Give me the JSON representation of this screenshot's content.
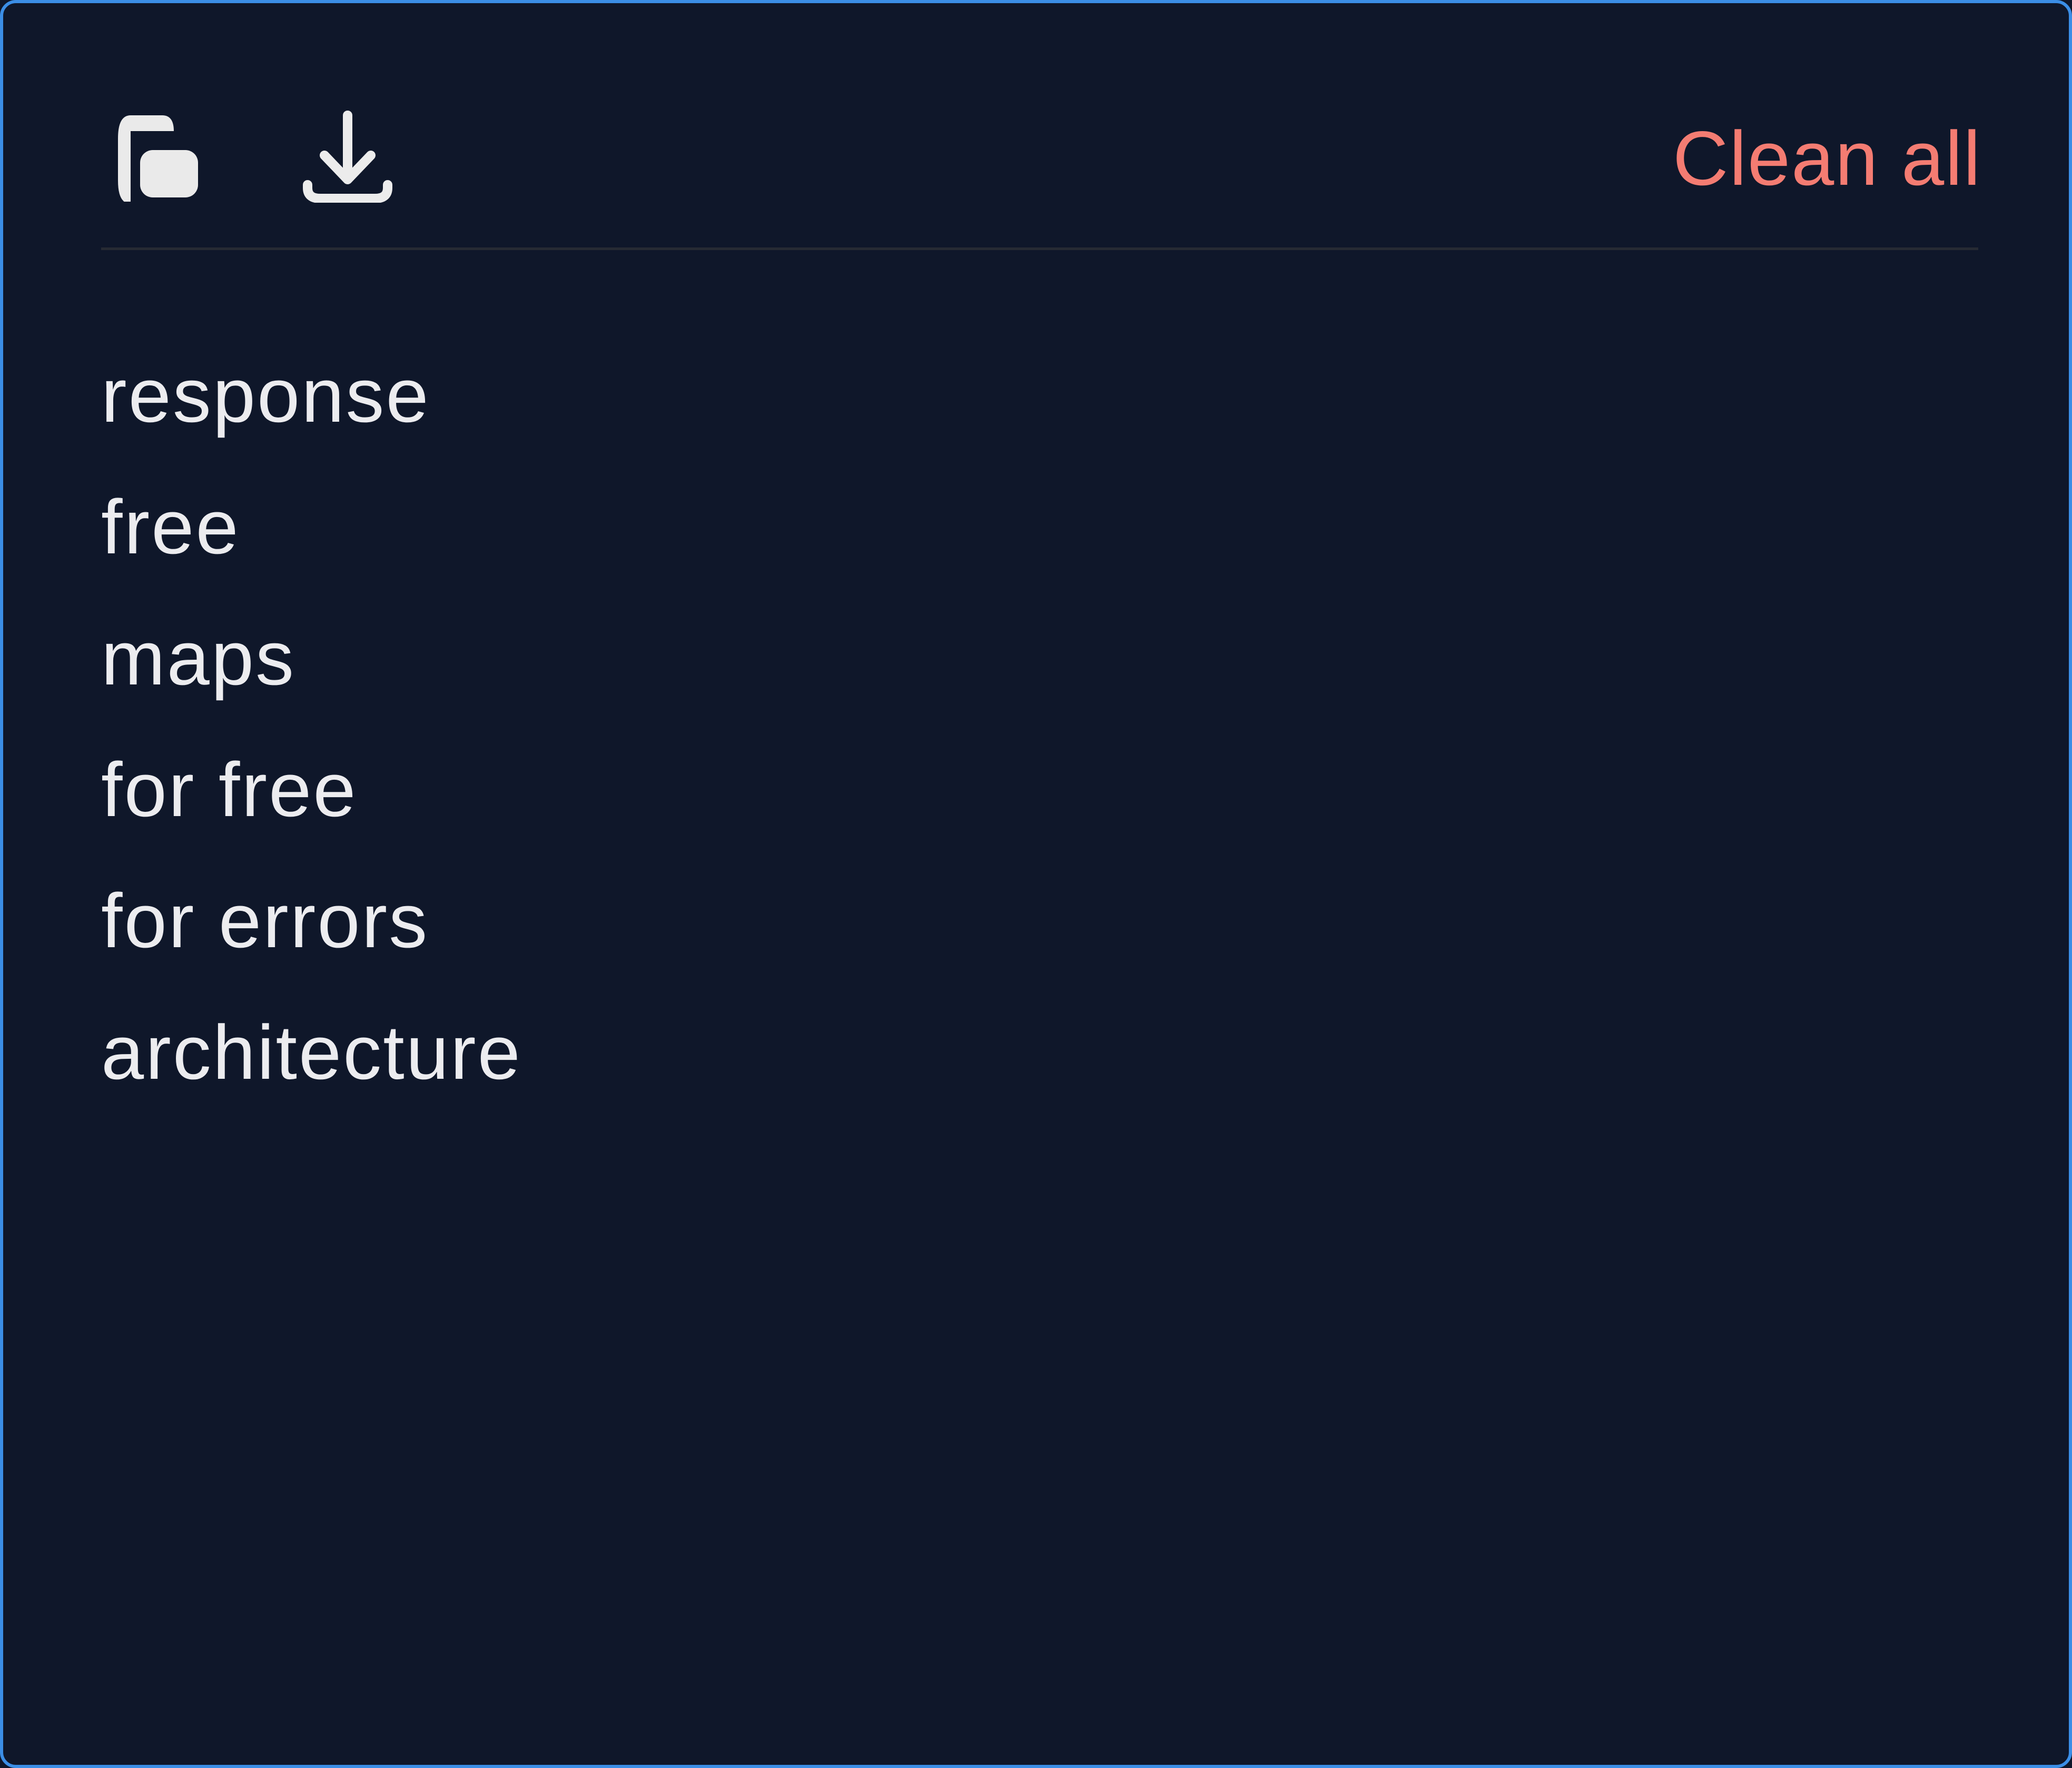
{
  "toolbar": {
    "copy_icon": "copy-icon",
    "download_icon": "download-icon",
    "clean_all_label": "Clean all"
  },
  "items": [
    "response",
    "free",
    "maps",
    "for free",
    "for errors",
    "architecture"
  ],
  "colors": {
    "background": "#0f172a",
    "border": "#3b8ee6",
    "danger": "#f47c72",
    "text": "#ececef",
    "divider": "#262a33"
  }
}
